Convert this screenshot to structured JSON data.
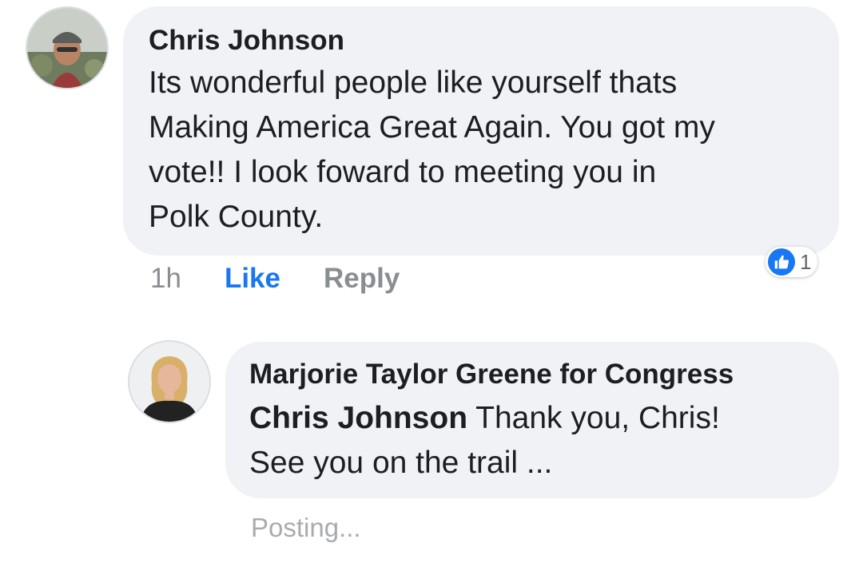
{
  "comment": {
    "author": "Chris Johnson",
    "text_lines": [
      "Its wonderful people like yourself thats",
      "Making America Great Again. You got my",
      "vote!! I look foward to meeting you in",
      "Polk County."
    ],
    "time": "1h",
    "like_label": "Like",
    "reply_label": "Reply",
    "reaction": {
      "icon": "thumbs-up-icon",
      "count": "1",
      "color": "#1877f2"
    }
  },
  "reply": {
    "author": "Marjorie Taylor Greene for Congress",
    "mention": "Chris Johnson",
    "text_line1": " Thank you, Chris!",
    "text_line2": "See you on the trail ...",
    "status": "Posting..."
  },
  "colors": {
    "bubble": "#f0f2f5",
    "link": "#1877f2",
    "muted": "#8a8d91"
  }
}
